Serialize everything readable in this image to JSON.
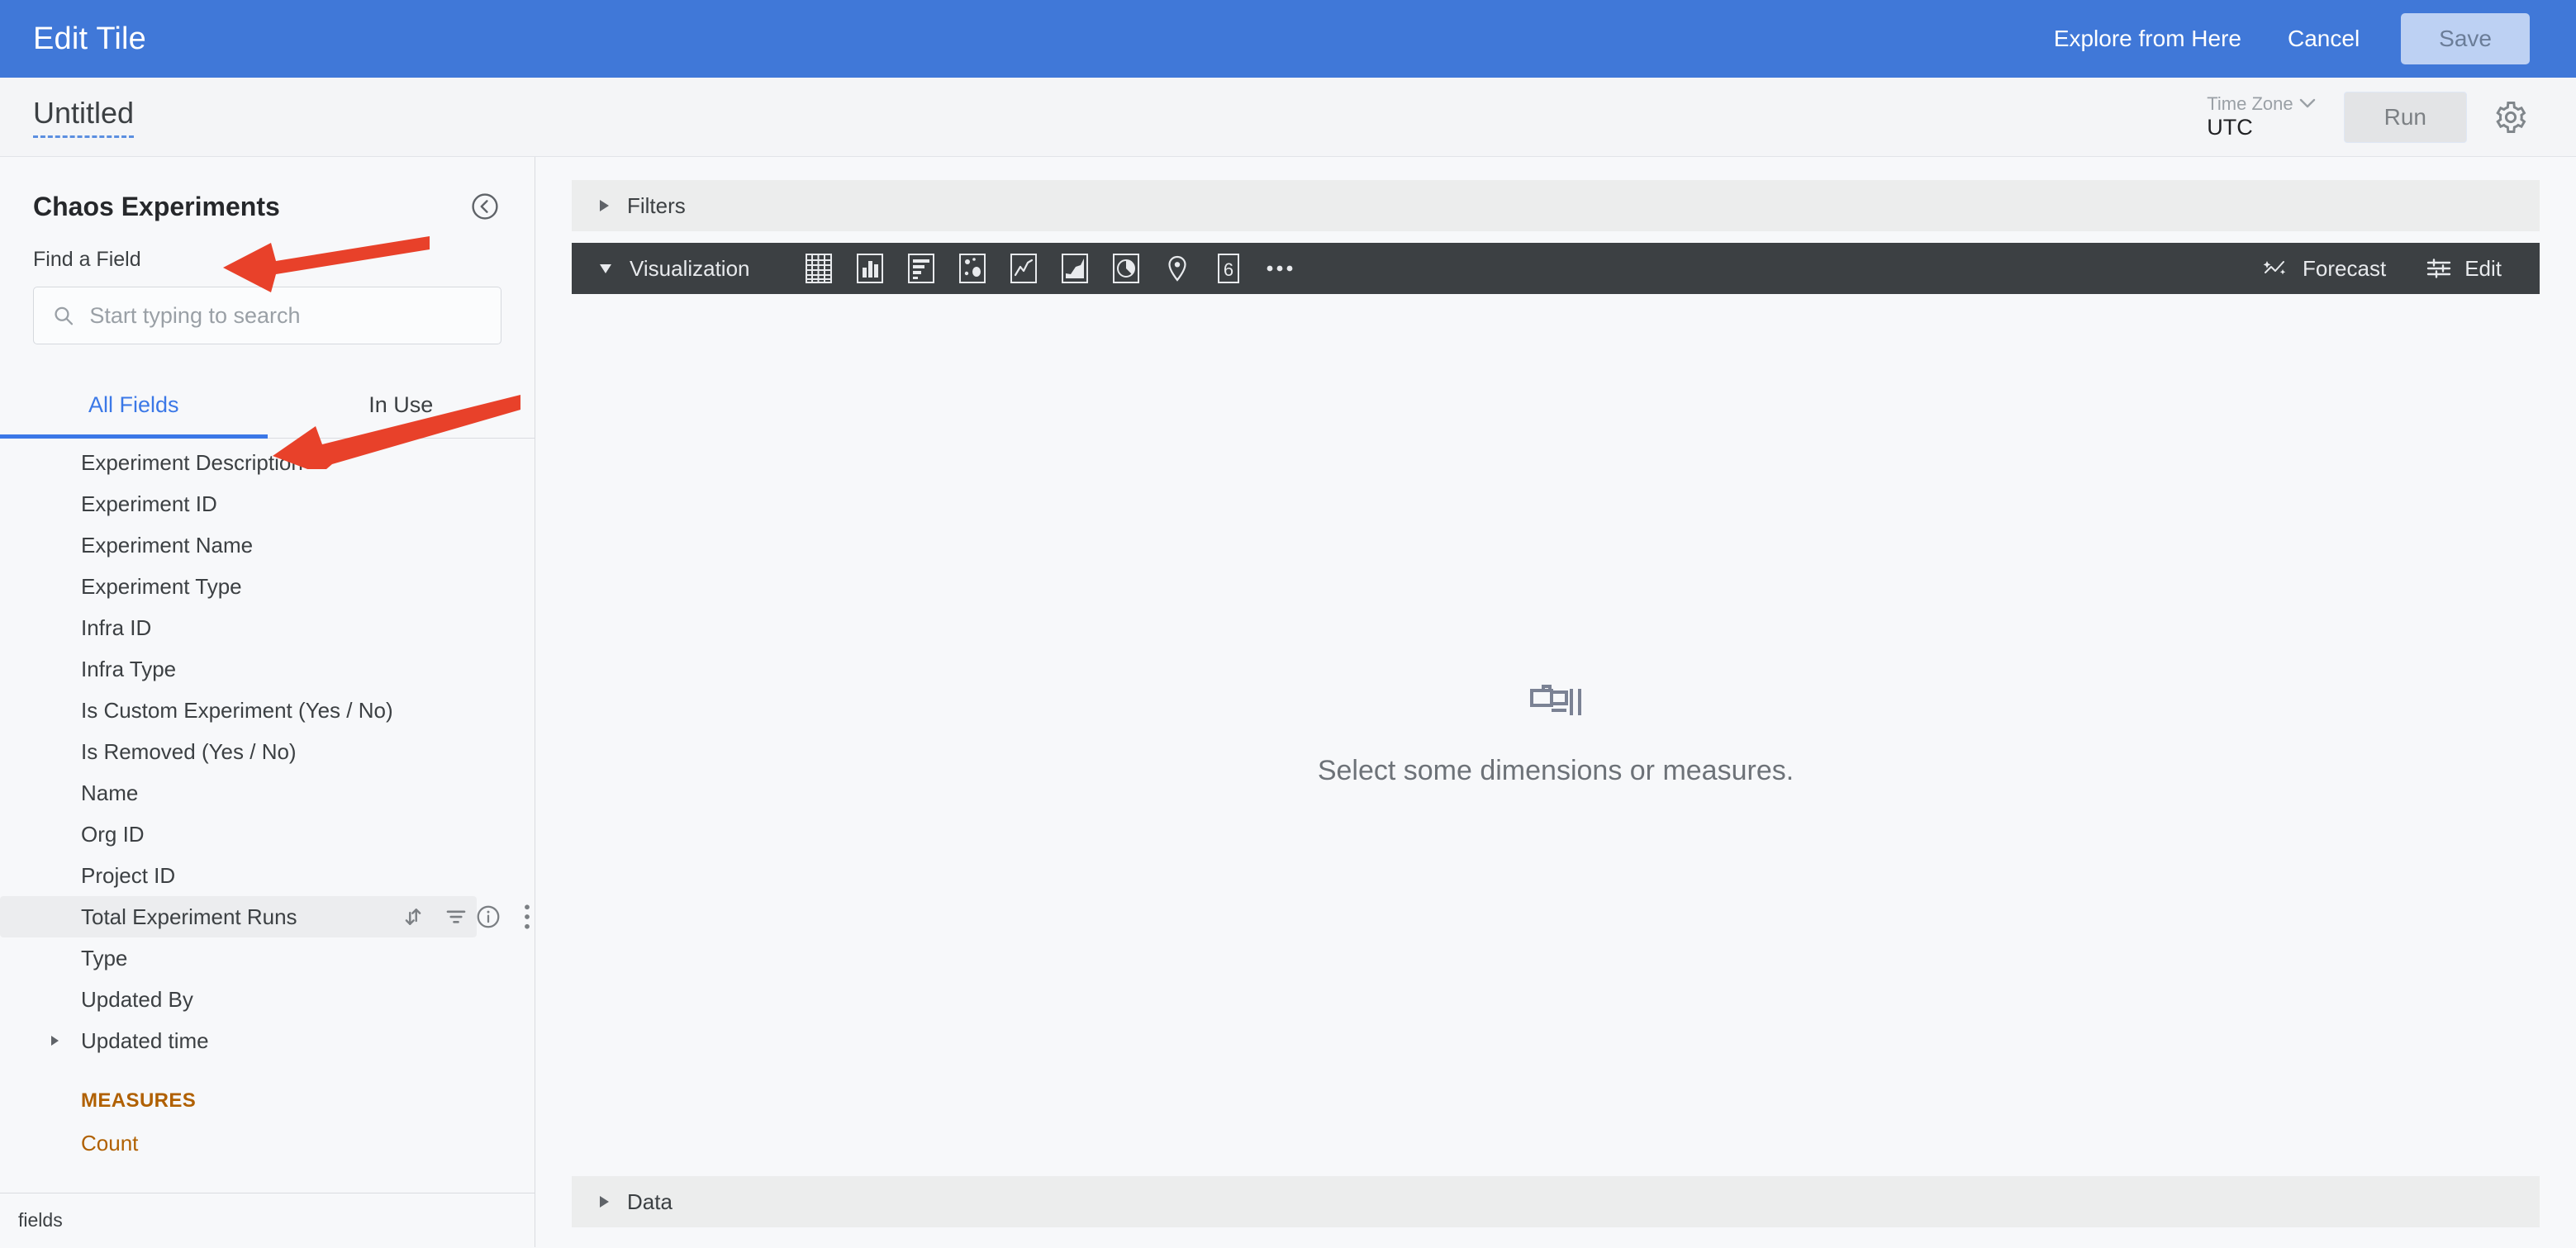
{
  "topbar": {
    "title": "Edit Tile",
    "explore_label": "Explore from Here",
    "cancel_label": "Cancel",
    "save_label": "Save"
  },
  "subbar": {
    "doc_title": "Untitled",
    "timezone_label": "Time Zone",
    "timezone_value": "UTC",
    "run_label": "Run"
  },
  "sidebar": {
    "title": "Chaos Experiments",
    "find_label": "Find a Field",
    "search_placeholder": "Start typing to search",
    "search_value": "",
    "tabs": [
      {
        "label": "All Fields",
        "active": true
      },
      {
        "label": "In Use",
        "active": false
      }
    ],
    "fields": [
      {
        "label": "Experiment Description",
        "expandable": false,
        "hovered": false
      },
      {
        "label": "Experiment ID",
        "expandable": false,
        "hovered": false
      },
      {
        "label": "Experiment Name",
        "expandable": false,
        "hovered": false
      },
      {
        "label": "Experiment Type",
        "expandable": false,
        "hovered": false
      },
      {
        "label": "Infra ID",
        "expandable": false,
        "hovered": false
      },
      {
        "label": "Infra Type",
        "expandable": false,
        "hovered": false
      },
      {
        "label": "Is Custom Experiment (Yes / No)",
        "expandable": false,
        "hovered": false
      },
      {
        "label": "Is Removed (Yes / No)",
        "expandable": false,
        "hovered": false
      },
      {
        "label": "Name",
        "expandable": false,
        "hovered": false
      },
      {
        "label": "Org ID",
        "expandable": false,
        "hovered": false
      },
      {
        "label": "Project ID",
        "expandable": false,
        "hovered": false
      },
      {
        "label": "Total Experiment Runs",
        "expandable": false,
        "hovered": true
      },
      {
        "label": "Type",
        "expandable": false,
        "hovered": false
      },
      {
        "label": "Updated By",
        "expandable": false,
        "hovered": false
      },
      {
        "label": "Updated time",
        "expandable": true,
        "hovered": false
      }
    ],
    "measures_group_label": "MEASURES",
    "measures": [
      {
        "label": "Count"
      }
    ],
    "footer_text": "fields",
    "row_action_icons": [
      "sort-icon",
      "filter-icon",
      "info-icon",
      "more-vertical-icon"
    ]
  },
  "main": {
    "filters_label": "Filters",
    "visualization_label": "Visualization",
    "vis_icons": [
      "table-chart-icon",
      "column-chart-icon",
      "bar-chart-icon",
      "scatter-chart-icon",
      "line-chart-icon",
      "area-chart-icon",
      "pie-chart-icon",
      "map-chart-icon",
      "single-value-icon",
      "more-horizontal-icon"
    ],
    "single_value_glyph": "6",
    "forecast_label": "Forecast",
    "edit_label": "Edit",
    "empty_message": "Select some dimensions or measures.",
    "empty_icon": "projector-icon",
    "data_label": "Data"
  },
  "annotations": {
    "arrow_color": "#e8412a",
    "arrows": [
      {
        "name": "arrow-to-experiment-type",
        "target": "Experiment Type"
      },
      {
        "name": "arrow-to-total-experiment-runs",
        "target": "Total Experiment Runs"
      }
    ]
  },
  "colors": {
    "brand_blue": "#4078d8",
    "accent_blue": "#3b78e7",
    "measure_orange": "#b06000",
    "dark_toolbar": "#3c4043"
  }
}
